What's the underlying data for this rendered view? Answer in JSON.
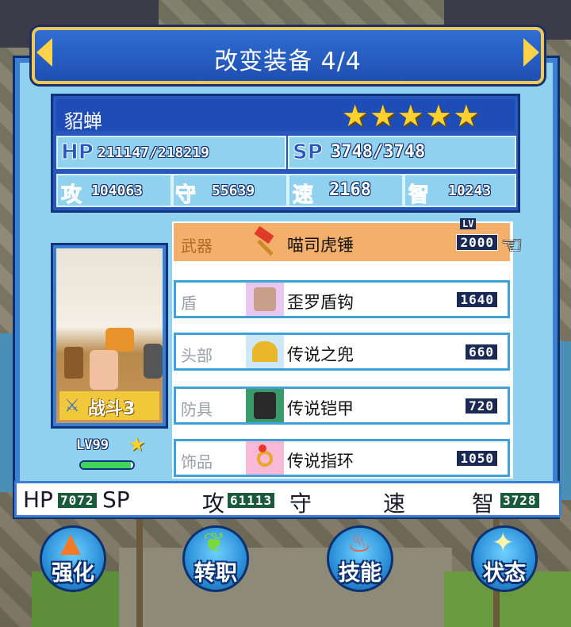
{
  "header": {
    "title": "改变装备 4/4"
  },
  "character": {
    "name": "貂蝉",
    "stars": 5,
    "hp_label": "HP",
    "hp_value": "211147/218219",
    "sp_label": "SP",
    "sp_value": "3748/3748",
    "atk_label": "攻",
    "atk_value": "104063",
    "def_label": "守",
    "def_value": "55639",
    "spd_label": "速",
    "spd_value": "2168",
    "int_label": "智",
    "int_value": "10243",
    "job_badge": "战斗3",
    "level_text": "LV99",
    "xp_fraction": 0.95
  },
  "equipment": {
    "lv_header": "LV",
    "slots": [
      {
        "slot": "武器",
        "item": "喵司虎锤",
        "level": "2000",
        "icon": "hammer-icon",
        "selected": true
      },
      {
        "slot": "盾",
        "item": "歪罗盾钩",
        "level": "1640",
        "icon": "cat-shield-icon",
        "selected": false
      },
      {
        "slot": "头部",
        "item": "传说之兜",
        "level": "660",
        "icon": "helmet-icon",
        "selected": false
      },
      {
        "slot": "防具",
        "item": "传说铠甲",
        "level": "720",
        "icon": "armor-icon",
        "selected": false
      },
      {
        "slot": "饰品",
        "item": "传说指环",
        "level": "1050",
        "icon": "ring-icon",
        "selected": false
      }
    ]
  },
  "bonus_strip": {
    "hp_label": "HP",
    "hp_value": "7072",
    "sp_label": "SP",
    "atk_label": "攻",
    "atk_value": "61113",
    "def_label": "守",
    "spd_label": "速",
    "int_label": "智",
    "int_value": "3728"
  },
  "actions": [
    {
      "label": "强化",
      "icon": "up-arrow-icon",
      "color": "#f07a2a"
    },
    {
      "label": "转职",
      "icon": "leaf-icon",
      "color": "#7ad83a"
    },
    {
      "label": "技能",
      "icon": "flame-icon",
      "color": "#f05a3a"
    },
    {
      "label": "状态",
      "icon": "sparkle-icon",
      "color": "#fff4a8"
    }
  ]
}
